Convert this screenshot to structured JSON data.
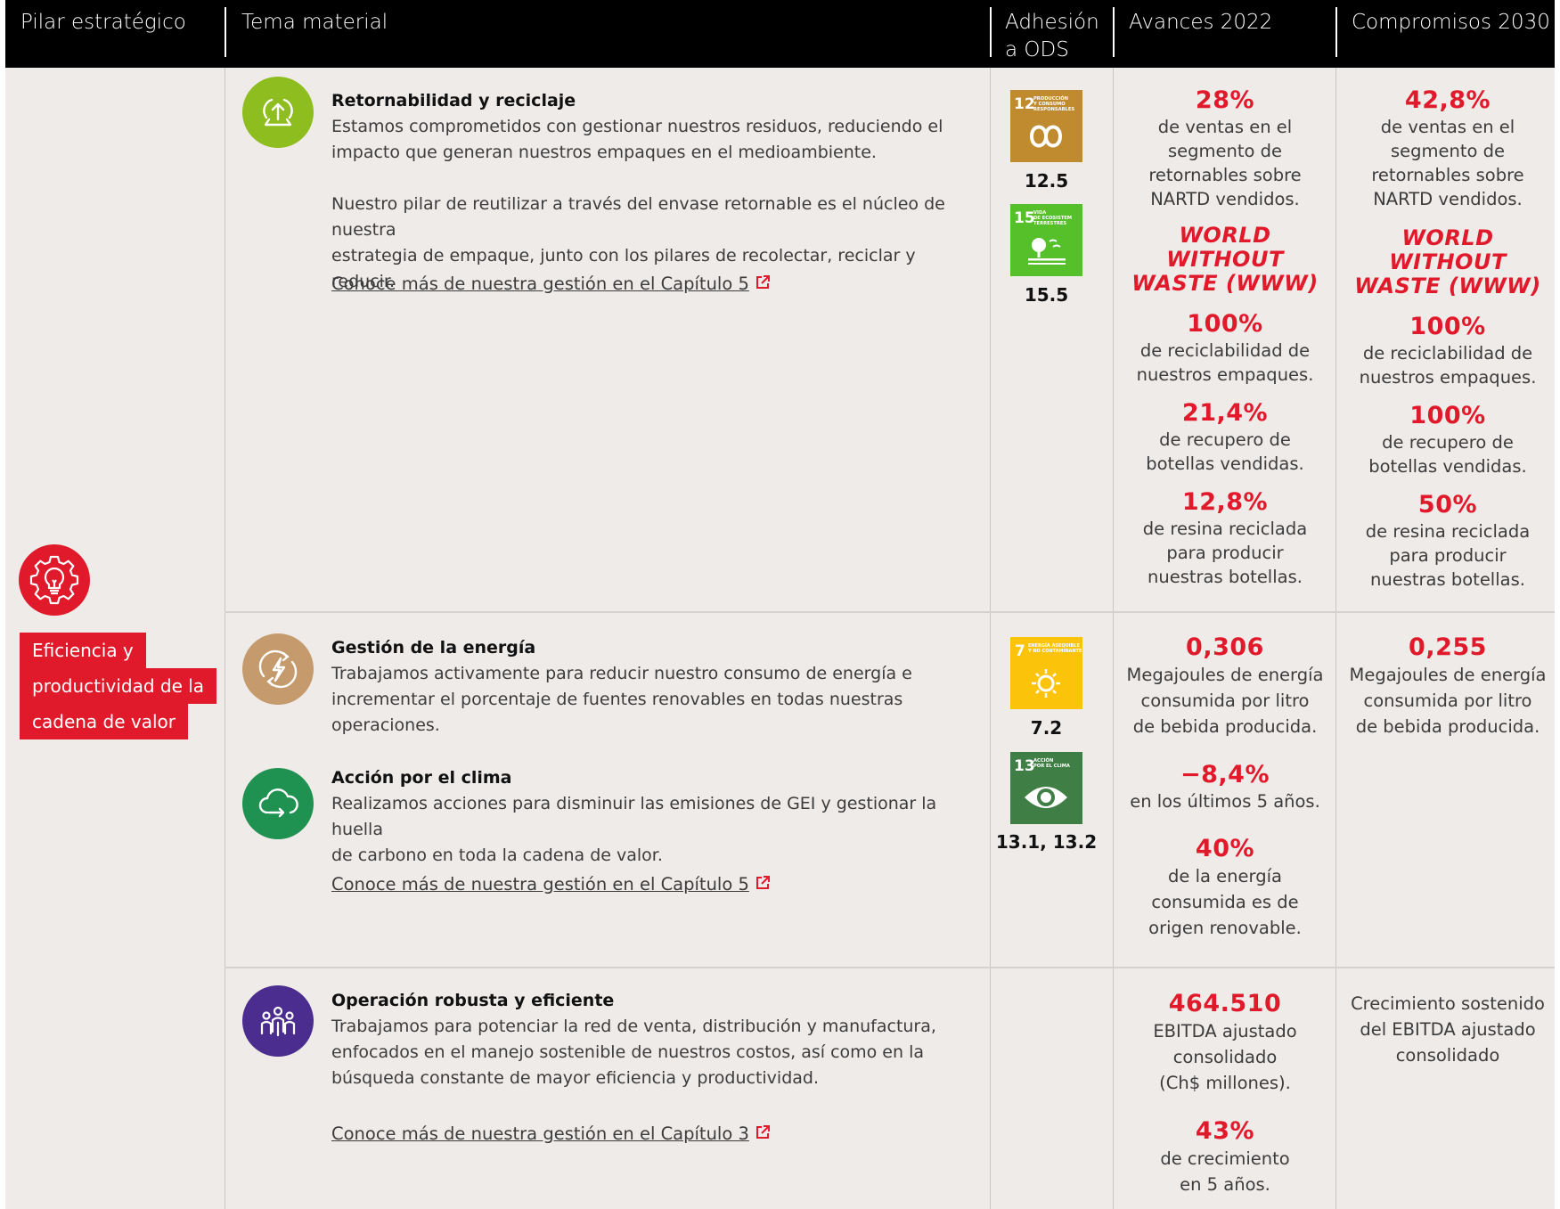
{
  "header": {
    "col_pillar": "Pilar estratégico",
    "col_topic": "Tema material",
    "col_ods_line1": "Adhesión",
    "col_ods_line2": "a ODS",
    "col_2022": "Avances 2022",
    "col_2030": "Compromisos 2030"
  },
  "pillar": {
    "icon": "gear-lightbulb-icon",
    "label_line1": "Eficiencia y",
    "label_line2": "productividad de la",
    "label_line3": "cadena de valor",
    "color": "#e01a2b"
  },
  "rows": {
    "reciclaje": {
      "icon": "recycle-upload-icon",
      "icon_color": "#8dbd1f",
      "title": "Retornabilidad y reciclaje",
      "p1_l1": "Estamos comprometidos con gestionar nuestros residuos, reduciendo el",
      "p1_l2": "impacto que generan nuestros empaques en el medioambiente.",
      "p2_l1": "Nuestro pilar de reutilizar a través del envase retornable es el núcleo de nuestra",
      "p2_l2": "estrategia de empaque, junto con los pilares de recolectar, reciclar y reducir.",
      "link": "Conoce más de nuestra gestión en el Capítulo 5",
      "ods": [
        {
          "number": "12",
          "label": "PRODUCCIÓN Y CONSUMO RESPONSABLES",
          "color": "#bf8b2e",
          "code": "12.5"
        },
        {
          "number": "15",
          "label": "VIDA DE ECOSISTEM TERRESTRES",
          "color": "#56c02b",
          "code": "15.5"
        }
      ],
      "avances": {
        "v1": "28%",
        "t1_l1": "de ventas en el",
        "t1_l2": "segmento de",
        "t1_l3": "retornables sobre",
        "t1_l4": "NARTD vendidos.",
        "www_l1": "WORLD WITHOUT",
        "www_l2": "WASTE (WWW)",
        "v2": "100%",
        "t2_l1": "de reciclabilidad de",
        "t2_l2": "nuestros empaques.",
        "v3": "21,4%",
        "t3_l1": "de recupero de",
        "t3_l2": "botellas vendidas.",
        "v4": "12,8%",
        "t4_l1": "de resina reciclada",
        "t4_l2": "para producir",
        "t4_l3": "nuestras botellas."
      },
      "compromisos": {
        "v1": "42,8%",
        "t1_l1": "de ventas en el",
        "t1_l2": "segmento de",
        "t1_l3": "retornables sobre",
        "t1_l4": "NARTD vendidos.",
        "www_l1": "WORLD WITHOUT",
        "www_l2": "WASTE (WWW)",
        "v2": "100%",
        "t2_l1": "de reciclabilidad de",
        "t2_l2": "nuestros empaques.",
        "v3": "100%",
        "t3_l1": "de recupero de",
        "t3_l2": "botellas vendidas.",
        "v4": "50%",
        "t4_l1": "de resina reciclada",
        "t4_l2": "para producir",
        "t4_l3": "nuestras botellas."
      }
    },
    "energia": {
      "icon": "lightning-cycle-icon",
      "icon_color": "#c59a6d",
      "title": "Gestión de la energía",
      "p1_l1": "Trabajamos activamente para reducir nuestro consumo de energía e",
      "p1_l2": "incrementar el porcentaje de fuentes renovables en todas nuestras",
      "p1_l3": "operaciones.",
      "ods": [
        {
          "number": "7",
          "label": "ENERGÍA ASEQUIBLE Y NO CONTAMINANTE",
          "color": "#fcc30b",
          "code": "7.2"
        },
        {
          "number": "13",
          "label": "ACCIÓN POR EL CLIMA",
          "color": "#3f7e44",
          "code": "13.1, 13.2"
        }
      ],
      "avances": {
        "v1": "0,306",
        "t1_l1": "Megajoules de energía",
        "t1_l2": "consumida por litro",
        "t1_l3": "de bebida producida.",
        "v2": "−8,4%",
        "t2_l1": "en los últimos 5 años.",
        "v3": "40%",
        "t3_l1": "de la energía",
        "t3_l2": "consumida es de",
        "t3_l3": "origen renovable."
      },
      "compromisos": {
        "v1": "0,255",
        "t1_l1": "Megajoules de energía",
        "t1_l2": "consumida por litro",
        "t1_l3": "de bebida producida."
      }
    },
    "clima": {
      "icon": "cloud-cycle-icon",
      "icon_color": "#1f9150",
      "title": "Acción por el clima",
      "p1_l1": "Realizamos acciones para disminuir las emisiones de GEI y gestionar la huella",
      "p1_l2": "de carbono en toda la cadena de valor.",
      "link": "Conoce más de nuestra gestión en el Capítulo 5"
    },
    "operacion": {
      "icon": "team-people-icon",
      "icon_color": "#4a2d8e",
      "title": "Operación robusta y eficiente",
      "p1_l1": "Trabajamos para potenciar la red de venta, distribución y manufactura,",
      "p1_l2": "enfocados en el manejo sostenible de nuestros costos, así como en la",
      "p1_l3": "búsqueda constante de mayor eficiencia y productividad.",
      "link": "Conoce más de nuestra gestión en el Capítulo 3",
      "avances": {
        "v1": "464.510",
        "t1_l1": "EBITDA ajustado",
        "t1_l2": "consolidado",
        "t1_l3": "(Ch$ millones).",
        "v2": "43%",
        "t2_l1": "de crecimiento",
        "t2_l2": "en 5 años."
      },
      "compromisos": {
        "t1_l1": "Crecimiento sostenido",
        "t1_l2": "del EBITDA ajustado",
        "t1_l3": "consolidado"
      }
    }
  }
}
